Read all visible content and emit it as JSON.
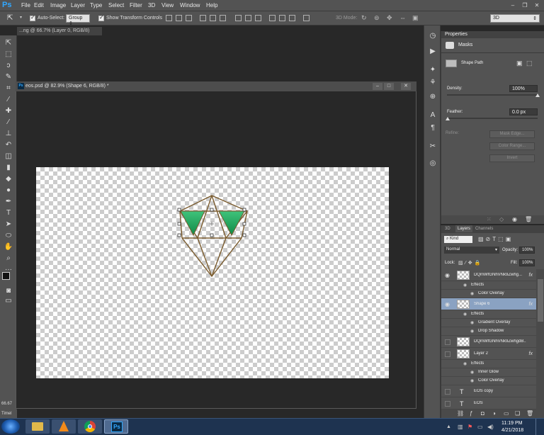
{
  "app": {
    "logo": "Ps",
    "menus": [
      "File",
      "Edit",
      "Image",
      "Layer",
      "Type",
      "Select",
      "Filter",
      "3D",
      "View",
      "Window",
      "Help"
    ]
  },
  "options": {
    "auto_select_label": "Auto-Select:",
    "group_value": "Group",
    "show_transform_label": "Show Transform Controls",
    "mode_3d_label": "3D Mode:",
    "workspace_value": "3D"
  },
  "documents": {
    "background_tab": "...ng @ 66.7% (Layer 0, RGB/8)",
    "active_title": "eos.psd @ 82.9% (Shape 6, RGB/8) *",
    "zoom": "66.67",
    "timeline": "Timel"
  },
  "properties": {
    "tab": "Properties",
    "section": "Masks",
    "shape_path": "Shape Path",
    "density_label": "Density:",
    "density_value": "100%",
    "feather_label": "Feather:",
    "feather_value": "0.0 px",
    "refine_label": "Refine:",
    "mask_edge": "Mask Edge...",
    "color_range": "Color Range...",
    "invert": "Invert"
  },
  "layers": {
    "tabs": [
      "3D",
      "Layers",
      "Channels"
    ],
    "kind": "Kind",
    "blend_mode": "Normal",
    "opacity_label": "Opacity:",
    "opacity_value": "100%",
    "lock_label": "Lock:",
    "fill_label": "Fill:",
    "fill_value": "100%",
    "rows": [
      {
        "name": "DQmWfGNhVNk9Zwhg...",
        "visible": true,
        "fx": true
      },
      {
        "name": "Effects",
        "sub": true
      },
      {
        "name": "Color Overlay",
        "sub2": true
      },
      {
        "name": "Shape 6",
        "visible": true,
        "fx": true,
        "selected": true
      },
      {
        "name": "Effects",
        "sub": true
      },
      {
        "name": "Gradient Overlay",
        "sub2": true
      },
      {
        "name": "Drop Shadow",
        "sub2": true
      },
      {
        "name": "DQmWfGNhVNk9ZwhgdB...",
        "visible": false
      },
      {
        "name": "Layer 2",
        "visible": false,
        "fx": true
      },
      {
        "name": "Effects",
        "sub": true
      },
      {
        "name": "Inner Glow",
        "sub2": true
      },
      {
        "name": "Color Overlay",
        "sub2": true
      },
      {
        "name": "EOS copy",
        "visible": false,
        "text": true
      },
      {
        "name": "EOS",
        "visible": false,
        "text": true
      }
    ],
    "fx_glyph": "fx"
  },
  "taskbar": {
    "time": "11:19 PM",
    "date": "4/21/2018"
  },
  "colors": {
    "accent": "#31a8ff",
    "selected_layer": "#8aa2c2",
    "shape_green": "#1ea35a",
    "shape_outline": "#7a5b2e"
  }
}
